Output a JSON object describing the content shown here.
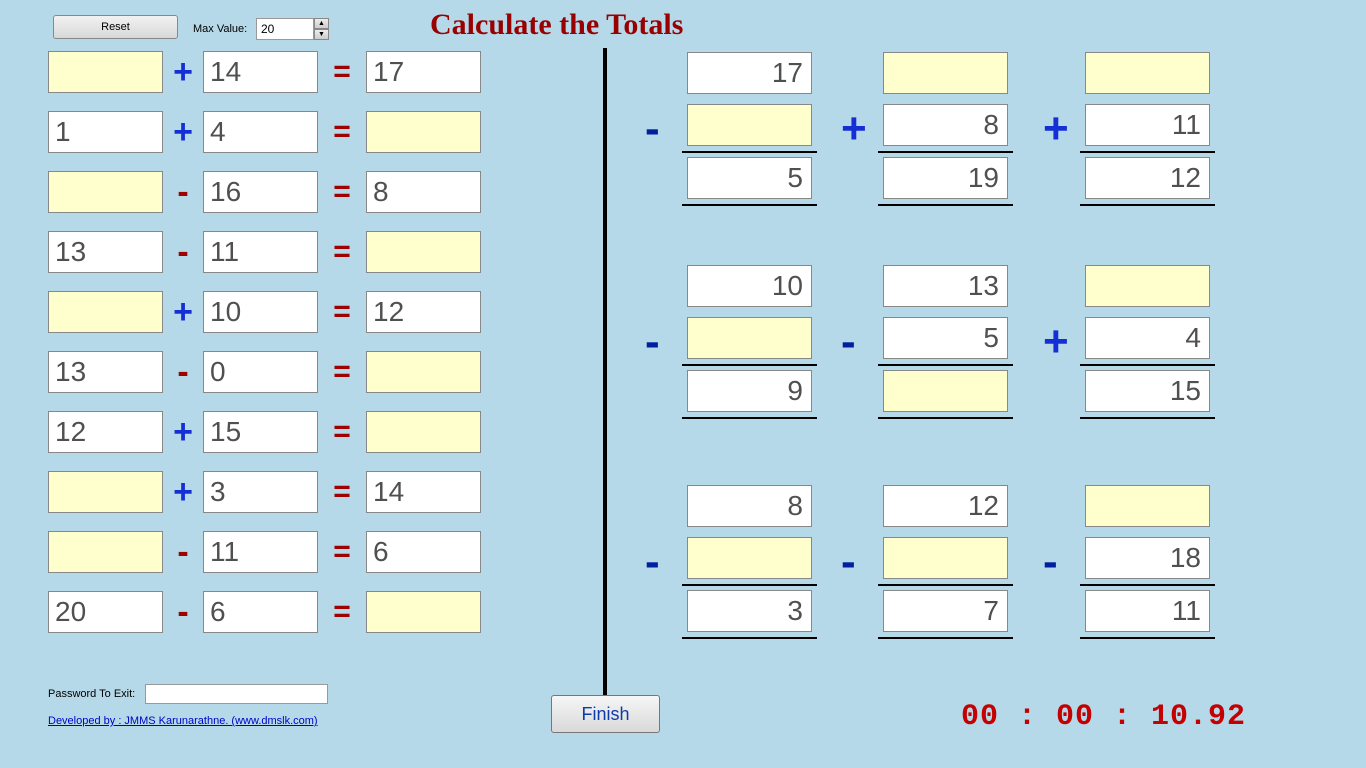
{
  "title": "Calculate the Totals",
  "reset_label": "Reset",
  "max_label": "Max Value:",
  "max_value": "20",
  "pwd_label": "Password To Exit:",
  "dev_link": "Developed by : JMMS Karunarathne. (www.dmslk.com)",
  "finish_label": "Finish",
  "timer": "00 : 00 : 10.92",
  "rows": [
    {
      "a": "",
      "op": "+",
      "b": "14",
      "r": "17",
      "ay": true,
      "by": false,
      "ry": false
    },
    {
      "a": "1",
      "op": "+",
      "b": "4",
      "r": "",
      "ay": false,
      "by": false,
      "ry": true
    },
    {
      "a": "",
      "op": "-",
      "b": "16",
      "r": "8",
      "ay": true,
      "by": false,
      "ry": false
    },
    {
      "a": "13",
      "op": "-",
      "b": "11",
      "r": "",
      "ay": false,
      "by": false,
      "ry": true
    },
    {
      "a": "",
      "op": "+",
      "b": "10",
      "r": "12",
      "ay": true,
      "by": false,
      "ry": false
    },
    {
      "a": "13",
      "op": "-",
      "b": "0",
      "r": "",
      "ay": false,
      "by": false,
      "ry": true
    },
    {
      "a": "12",
      "op": "+",
      "b": "15",
      "r": "",
      "ay": false,
      "by": false,
      "ry": true
    },
    {
      "a": "",
      "op": "+",
      "b": "3",
      "r": "14",
      "ay": true,
      "by": false,
      "ry": false
    },
    {
      "a": "",
      "op": "-",
      "b": "11",
      "r": "6",
      "ay": true,
      "by": false,
      "ry": false
    },
    {
      "a": "20",
      "op": "-",
      "b": "6",
      "r": "",
      "ay": false,
      "by": false,
      "ry": true
    }
  ],
  "vgroups": [
    [
      {
        "op": "-",
        "t": "17",
        "m": "",
        "b": "5",
        "ty": false,
        "my": true,
        "by": false
      },
      {
        "op": "+",
        "t": "",
        "m": "8",
        "b": "19",
        "ty": true,
        "my": false,
        "by": false
      },
      {
        "op": "+",
        "t": "",
        "m": "11",
        "b": "12",
        "ty": true,
        "my": false,
        "by": false
      }
    ],
    [
      {
        "op": "-",
        "t": "10",
        "m": "",
        "b": "9",
        "ty": false,
        "my": true,
        "by": false
      },
      {
        "op": "-",
        "t": "13",
        "m": "5",
        "b": "",
        "ty": false,
        "my": false,
        "by": true
      },
      {
        "op": "+",
        "t": "",
        "m": "4",
        "b": "15",
        "ty": true,
        "my": false,
        "by": false
      }
    ],
    [
      {
        "op": "-",
        "t": "8",
        "m": "",
        "b": "3",
        "ty": false,
        "my": true,
        "by": false
      },
      {
        "op": "-",
        "t": "12",
        "m": "",
        "b": "7",
        "ty": false,
        "my": true,
        "by": false
      },
      {
        "op": "-",
        "t": "",
        "m": "18",
        "b": "11",
        "ty": true,
        "my": false,
        "by": false
      }
    ]
  ]
}
